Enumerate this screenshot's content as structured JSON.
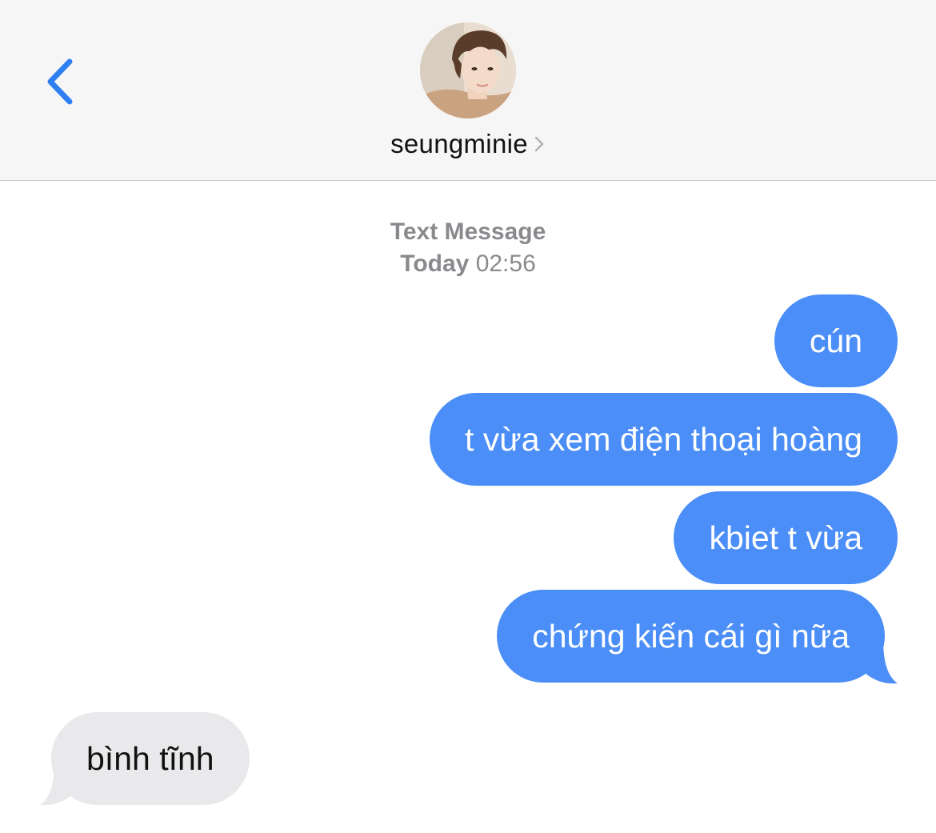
{
  "header": {
    "back_icon": "chevron-left-icon",
    "contact_name": "seungminie",
    "contact_chevron_icon": "chevron-right-icon",
    "accent_color": "#2f80f2"
  },
  "thread_meta": {
    "service_label": "Text Message",
    "day_label": "Today",
    "time_label": "02:56"
  },
  "messages": [
    {
      "direction": "sent",
      "text": "cún"
    },
    {
      "direction": "sent",
      "text": "t vừa xem điện thoại hoàng"
    },
    {
      "direction": "sent",
      "text": "kbiet t vừa"
    },
    {
      "direction": "sent",
      "text": "chứng kiến cái gì nữa"
    },
    {
      "direction": "received",
      "text": "bình tĩnh"
    }
  ],
  "colors": {
    "sent_bubble": "#4b8ef7",
    "received_bubble": "#e9e9eb",
    "header_bg": "#f6f6f6",
    "meta_text": "#8a8a8e"
  }
}
